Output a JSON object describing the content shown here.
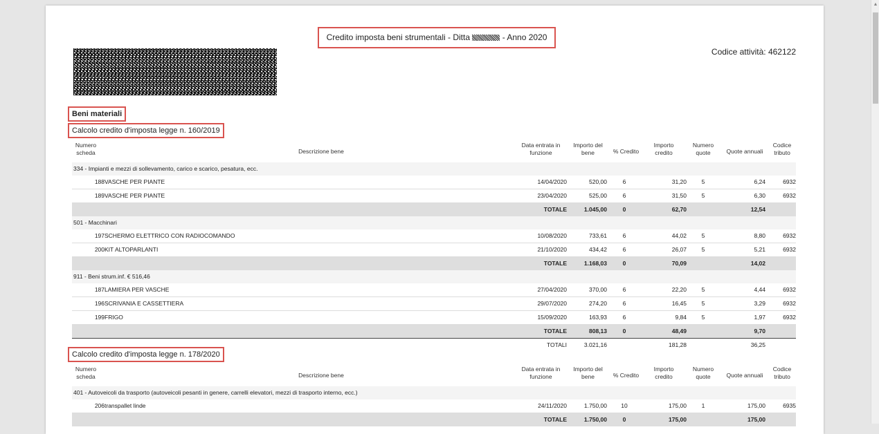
{
  "header": {
    "title_prefix": "Credito imposta beni strumentali - Ditta",
    "title_suffix": "- Anno 2020",
    "codice_attivita": "Codice attività: 462122"
  },
  "section_title": "Beni materiali",
  "columns": {
    "numero": "Numero scheda",
    "desc": "Descrizione bene",
    "data": "Data entrata in funzione",
    "importo": "Importo del bene",
    "perc": "% Credito",
    "credito": "Importo credito",
    "nq": "Numero quote",
    "qa": "Quote annuali",
    "cod": "Codice tributo"
  },
  "labels": {
    "totale": "TOTALE",
    "totali": "TOTALI"
  },
  "table1": {
    "title": "Calcolo credito d'imposta legge n. 160/2019",
    "cat1": {
      "name": "334 - Impianti e mezzi di sollevamento, carico e scarico, pesatura, ecc.",
      "rows": [
        {
          "num": "188",
          "desc": "VASCHE PER PIANTE",
          "date": "14/04/2020",
          "imp": "520,00",
          "perc": "6",
          "cred": "31,20",
          "nq": "5",
          "qa": "6,24",
          "cod": "6932"
        },
        {
          "num": "189",
          "desc": "VASCHE PER PIANTE",
          "date": "23/04/2020",
          "imp": "525,00",
          "perc": "6",
          "cred": "31,50",
          "nq": "5",
          "qa": "6,30",
          "cod": "6932"
        }
      ],
      "total": {
        "imp": "1.045,00",
        "perc": "0",
        "cred": "62,70",
        "qa": "12,54"
      }
    },
    "cat2": {
      "name": "501 - Macchinari",
      "rows": [
        {
          "num": "197",
          "desc": "SCHERMO ELETTRICO CON RADIOCOMANDO",
          "date": "10/08/2020",
          "imp": "733,61",
          "perc": "6",
          "cred": "44,02",
          "nq": "5",
          "qa": "8,80",
          "cod": "6932"
        },
        {
          "num": "200",
          "desc": "KIT ALTOPARLANTI",
          "date": "21/10/2020",
          "imp": "434,42",
          "perc": "6",
          "cred": "26,07",
          "nq": "5",
          "qa": "5,21",
          "cod": "6932"
        }
      ],
      "total": {
        "imp": "1.168,03",
        "perc": "0",
        "cred": "70,09",
        "qa": "14,02"
      }
    },
    "cat3": {
      "name": "911 - Beni strum.inf. € 516,46",
      "rows": [
        {
          "num": "187",
          "desc": "LAMIERA PER VASCHE",
          "date": "27/04/2020",
          "imp": "370,00",
          "perc": "6",
          "cred": "22,20",
          "nq": "5",
          "qa": "4,44",
          "cod": "6932"
        },
        {
          "num": "196",
          "desc": "SCRIVANIA E CASSETTIERA",
          "date": "29/07/2020",
          "imp": "274,20",
          "perc": "6",
          "cred": "16,45",
          "nq": "5",
          "qa": "3,29",
          "cod": "6932"
        },
        {
          "num": "199",
          "desc": "FRIGO",
          "date": "15/09/2020",
          "imp": "163,93",
          "perc": "6",
          "cred": "9,84",
          "nq": "5",
          "qa": "1,97",
          "cod": "6932"
        }
      ],
      "total": {
        "imp": "808,13",
        "perc": "0",
        "cred": "48,49",
        "qa": "9,70"
      }
    },
    "grand": {
      "imp": "3.021,16",
      "cred": "181,28",
      "qa": "36,25"
    }
  },
  "table2": {
    "title": "Calcolo credito d'imposta legge n. 178/2020",
    "cat1": {
      "name": "401 - Autoveicoli da trasporto (autoveicoli pesanti in genere, carrelli elevatori, mezzi di trasporto interno, ecc.)",
      "rows": [
        {
          "num": "206",
          "desc": "transpallet linde",
          "date": "24/11/2020",
          "imp": "1.750,00",
          "perc": "10",
          "cred": "175,00",
          "nq": "1",
          "qa": "175,00",
          "cod": "6935"
        }
      ],
      "total": {
        "imp": "1.750,00",
        "perc": "0",
        "cred": "175,00",
        "qa": "175,00"
      }
    }
  }
}
